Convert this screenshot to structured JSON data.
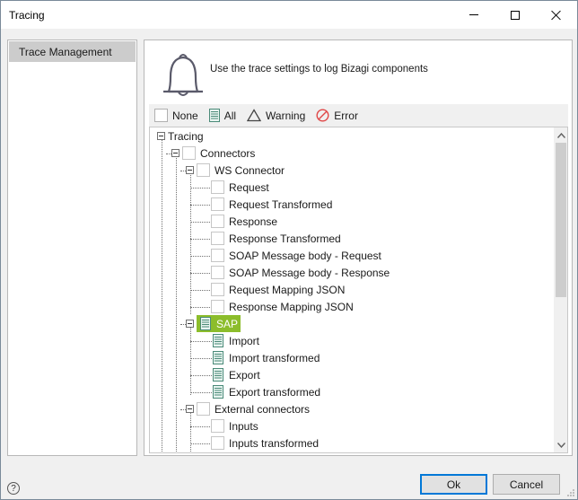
{
  "window": {
    "title": "Tracing"
  },
  "nav": {
    "items": [
      {
        "label": "Trace Management"
      }
    ]
  },
  "header": {
    "description": "Use the trace settings to log Bizagi components",
    "icon": "bell-icon"
  },
  "toolbar": {
    "none_label": "None",
    "all_label": "All",
    "warning_label": "Warning",
    "error_label": "Error"
  },
  "tree": {
    "root": "Tracing",
    "connectors": "Connectors",
    "ws_connector": "WS Connector",
    "ws_items": [
      "Request",
      "Request Transformed",
      "Response",
      "Response Transformed",
      "SOAP Message body - Request",
      "SOAP Message body - Response",
      "Request Mapping JSON",
      "Response Mapping JSON"
    ],
    "sap": "SAP",
    "sap_items": [
      "Import",
      "Import transformed",
      "Export",
      "Export transformed"
    ],
    "external": "External connectors",
    "external_items": [
      "Inputs",
      "Inputs transformed"
    ]
  },
  "footer": {
    "ok_label": "Ok",
    "cancel_label": "Cancel",
    "help_glyph": "?"
  },
  "colors": {
    "selected": "#8cbd2b",
    "accent": "#0078d7",
    "error": "#e04848"
  }
}
